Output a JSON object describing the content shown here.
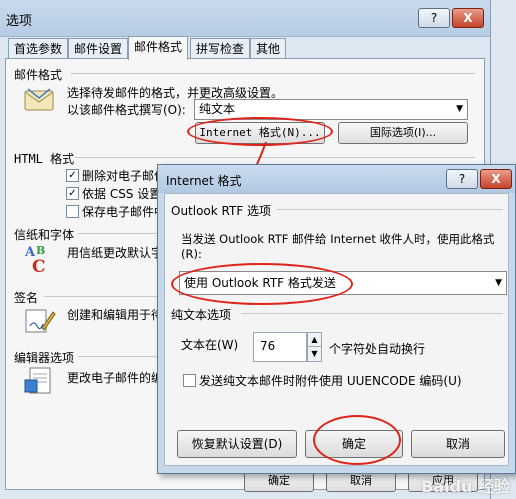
{
  "options_window": {
    "title": "选项",
    "help_btn": "?",
    "close_btn": "X",
    "tabs": [
      "首选参数",
      "邮件设置",
      "邮件格式",
      "拼写检查",
      "其他"
    ],
    "active_tab": "邮件格式",
    "mail_format": {
      "section": "邮件格式",
      "desc": "选择待发邮件的格式，并更改高级设置。",
      "compose_label": "以该邮件格式撰写(O):",
      "compose_value": "纯文本",
      "internet_format_btn": "Internet 格式(N)...",
      "intl_options_btn": "国际选项(I)..."
    },
    "html_format": {
      "section": "HTML 格式",
      "items": [
        {
          "label": "删除对电子邮件",
          "checked": true
        },
        {
          "label": "依据 CSS 设置",
          "checked": true
        },
        {
          "label": "保存电子邮件中",
          "checked": false
        }
      ]
    },
    "stationery": {
      "section": "信纸和字体",
      "desc": "用信纸更改默认字"
    },
    "signature": {
      "section": "签名",
      "desc": "创建和编辑用于待"
    },
    "editor": {
      "section": "编辑器选项",
      "desc": "更改电子邮件的编"
    },
    "bottom_buttons": {
      "ok": "确定",
      "cancel": "取消",
      "apply": "应用"
    }
  },
  "internet_format_dialog": {
    "title": "Internet 格式",
    "help_btn": "?",
    "close_btn": "X",
    "rtf_section": "Outlook RTF 选项",
    "rtf_desc_line1": "当发送 Outlook RTF 邮件给 Internet 收件人时，使用此格式",
    "rtf_desc_line2": "(R):",
    "rtf_select_value": "使用 Outlook RTF 格式发送",
    "plain_section": "纯文本选项",
    "wrap_label": "文本在(W)",
    "wrap_value": "76",
    "wrap_suffix": "个字符处自动换行",
    "uuencode_label": "发送纯文本邮件时附件使用 UUENCODE 编码(U)",
    "uuencode_checked": false,
    "restore_btn": "恢复默认设置(D)",
    "ok_btn": "确定",
    "cancel_btn": "取消"
  },
  "watermark": "Baidu 经验"
}
